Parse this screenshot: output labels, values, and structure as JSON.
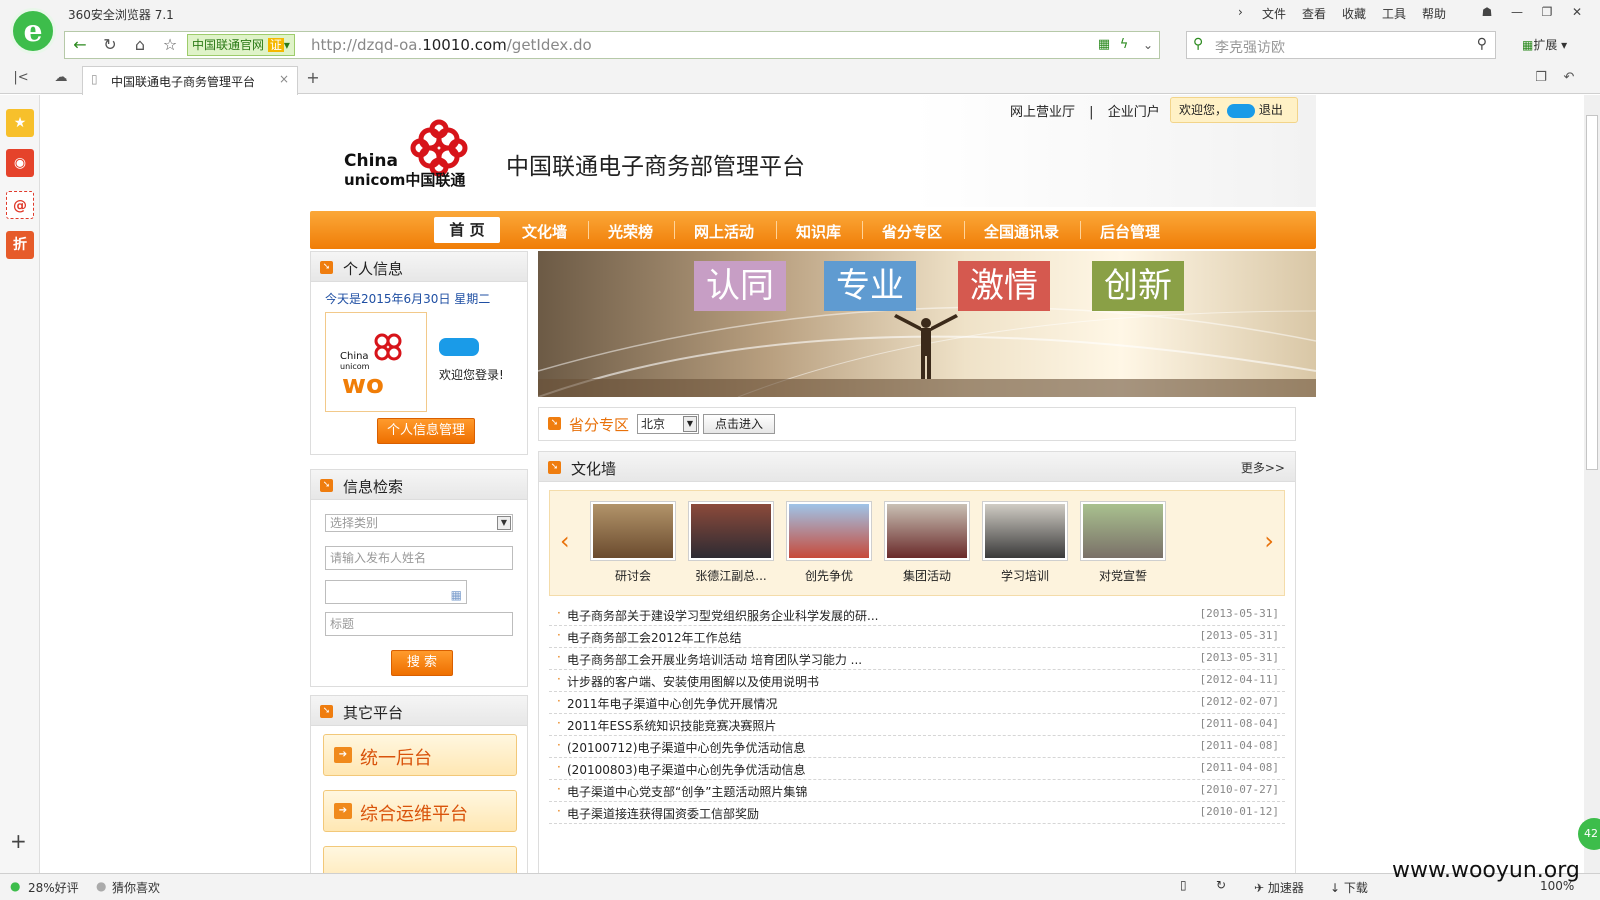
{
  "browser": {
    "app_title": "360安全浏览器 7.1",
    "menu": [
      "文件",
      "查看",
      "收藏",
      "工具",
      "帮助"
    ],
    "site_badge": "中国联通官网",
    "site_badge_cert": "证",
    "url_prefix": "http://dzqd-oa.",
    "url_domain": "10010.com",
    "url_path": "/getIdex.do",
    "search_placeholder": "李克强访欧",
    "extend_label": "扩展",
    "tab_title": "中国联通电子商务管理平台",
    "status_left": [
      "28%好评",
      "猜你喜欢"
    ],
    "status_right": [
      "加速器",
      "下载",
      "100%"
    ],
    "watermark": "www.wooyun.org",
    "side_badge": "42"
  },
  "header": {
    "links": [
      "网上营业厅",
      "企业门户"
    ],
    "link_sep": "|",
    "welcome": "欢迎您，",
    "logout": "退出",
    "logo_text_1": "China",
    "logo_text_2": "unicom中国联通",
    "site_title": "中国联通电子商务部管理平台"
  },
  "nav": {
    "items": [
      "首 页",
      "文化墙",
      "光荣榜",
      "网上活动",
      "知识库",
      "省分专区",
      "全国通讯录",
      "后台管理"
    ]
  },
  "personal": {
    "title": "个人信息",
    "date": "今天是2015年6月30日  星期二",
    "welcome": "欢迎您登录!",
    "manage_btn": "个人信息管理"
  },
  "search": {
    "title": "信息检索",
    "category_placeholder": "选择类别",
    "publisher_placeholder": "请输入发布人姓名",
    "title_placeholder": "标题",
    "search_btn": "搜 索"
  },
  "platforms": {
    "title": "其它平台",
    "items": [
      "统一后台",
      "综合运维平台"
    ]
  },
  "banner": {
    "words": [
      "认同",
      "专业",
      "激情",
      "创新"
    ]
  },
  "province": {
    "title": "省分专区",
    "selected": "北京",
    "enter_btn": "点击进入"
  },
  "culture": {
    "title": "文化墙",
    "more": "更多>>",
    "photos": [
      "研讨会",
      "张德江副总...",
      "创先争优",
      "集团活动",
      "学习培训",
      "对党宣誓"
    ],
    "news": [
      {
        "title": "电子商务部关于建设学习型党组织服务企业科学发展的研...",
        "date": "[2013-05-31]"
      },
      {
        "title": "电子商务部工会2012年工作总结",
        "date": "[2013-05-31]"
      },
      {
        "title": "电子商务部工会开展业务培训活动 培育团队学习能力 ...",
        "date": "[2013-05-31]"
      },
      {
        "title": "计步器的客户端、安装使用图解以及使用说明书",
        "date": "[2012-04-11]"
      },
      {
        "title": "2011年电子渠道中心创先争优开展情况",
        "date": "[2012-02-07]"
      },
      {
        "title": "2011年ESS系统知识技能竞赛决赛照片",
        "date": "[2011-08-04]"
      },
      {
        "title": "(20100712)电子渠道中心创先争优活动信息",
        "date": "[2011-04-08]"
      },
      {
        "title": "(20100803)电子渠道中心创先争优活动信息",
        "date": "[2011-04-08]"
      },
      {
        "title": "电子渠道中心党支部“创争”主题活动照片集锦",
        "date": "[2010-07-27]"
      },
      {
        "title": "电子渠道接连获得国资委工信部奖励",
        "date": "[2010-01-12]"
      }
    ]
  },
  "colors": {
    "accent_orange": "#f07d07",
    "browser_green": "#3dbd4b",
    "unicom_red": "#d7141a"
  }
}
